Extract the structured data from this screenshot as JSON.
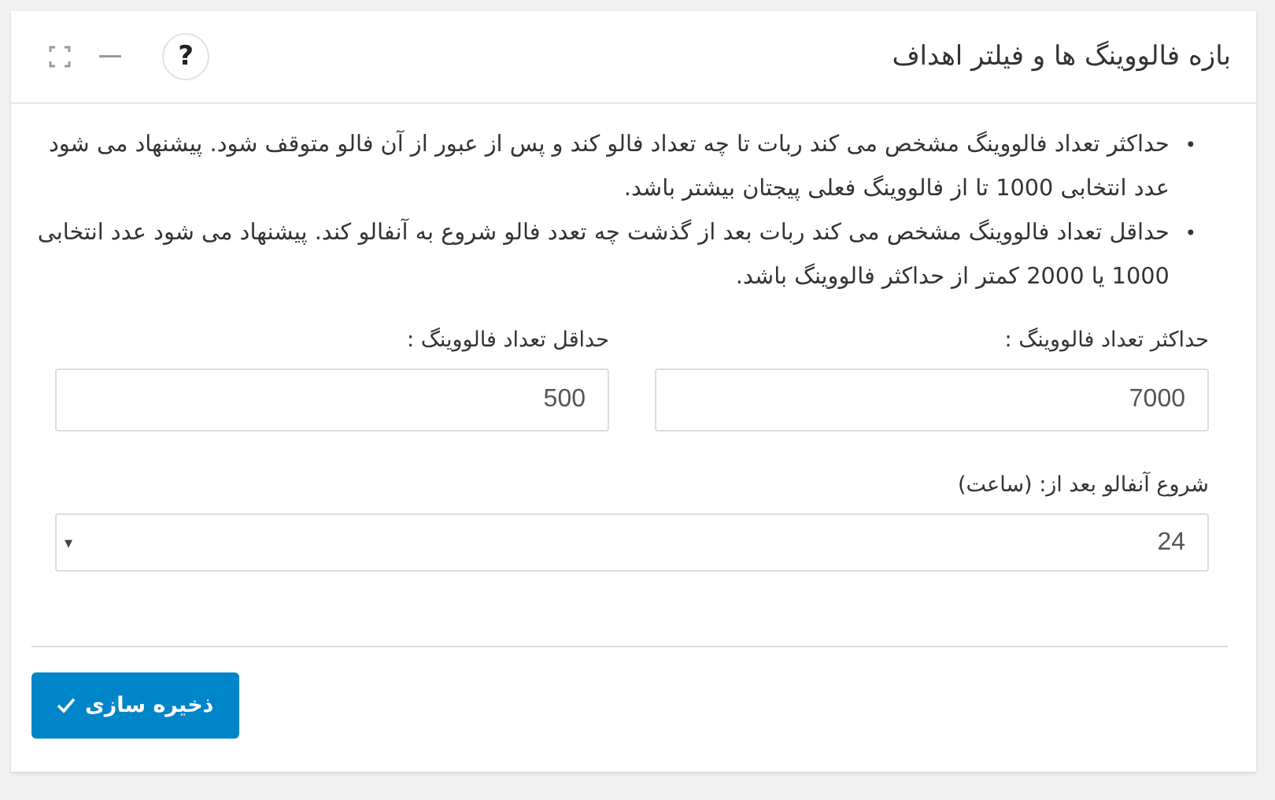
{
  "panel": {
    "title": "بازه فالووینگ ها و فیلتر اهداف",
    "help_icon": "?"
  },
  "note_bullet": "•",
  "notes": [
    "حداکثر تعداد فالووینگ مشخص می کند ربات تا چه تعداد فالو کند و پس از عبور از آن فالو متوقف شود. پیشنهاد می شود عدد انتخابی 1000 تا از فالووینگ فعلی پیجتان بیشتر باشد.",
    "حداقل تعداد فالووینگ مشخص می کند ربات بعد از گذشت چه تعدد فالو شروع به آنفالو کند. پیشنهاد می شود عدد انتخابی 1000 یا 2000 کمتر از حداکثر فالووینگ باشد."
  ],
  "fields": [
    {
      "kind": "input",
      "label": "حداکثر تعداد فالووینگ :",
      "value": "7000"
    },
    {
      "kind": "input",
      "label": "حداقل تعداد فالووینگ :",
      "value": "500"
    },
    {
      "kind": "select",
      "label": "شروع آنفالو بعد از: (ساعت)",
      "value": "24",
      "caret": "▾"
    }
  ],
  "save_button": "ذخیره سازی"
}
